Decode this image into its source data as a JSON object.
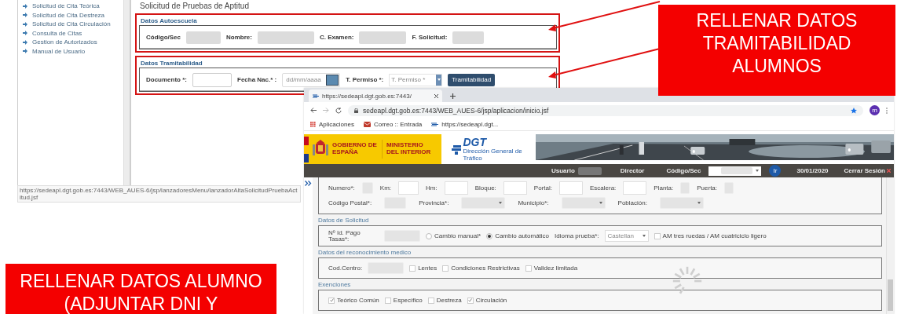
{
  "tutorial_screen": {
    "menu_items": [
      "Solicitud de Cita Teórica",
      "Solicitud de Cita Destreza",
      "Solicitud de Cita Circulación",
      "Consulta de Citas",
      "Gestion de Autorizados",
      "Manual de Usuario"
    ],
    "page_title": "Solicitud de Pruebas de Aptitud",
    "sections": [
      {
        "title": "Datos Autoescuela",
        "highlighted": true,
        "fields": [
          {
            "label": "Código/Sec",
            "kind": "blurred"
          },
          {
            "label": "Nombre:",
            "kind": "blurred"
          },
          {
            "label": "C. Examen:",
            "kind": "blurred"
          },
          {
            "label": "F. Solicitud:",
            "kind": "blurred"
          }
        ]
      },
      {
        "title": "Datos Tramitabilidad",
        "highlighted": true,
        "fields": [
          {
            "label": "Documento *:",
            "kind": "input"
          },
          {
            "label": "Fecha Nac.* :",
            "kind": "date",
            "placeholder": "dd/mm/aaaa"
          },
          {
            "label": "T. Permiso *:",
            "kind": "select",
            "placeholder": "T. Permiso *"
          },
          {
            "label": "Tramitabilidad",
            "kind": "button"
          }
        ]
      }
    ],
    "status_url": "https://sedeapl.dgt.gob.es:7443/WEB_AUES-6/jsp/lanzadoresMenu/lanzadorAltaSolicitudPruebaActitud.jsf"
  },
  "callouts": [
    {
      "text": "RELLENAR DATOS\nTRAMITABILIDAD\nALUMNOS"
    },
    {
      "text": "RELLENAR DATOS ALUMNO\n(ADJUNTAR DNI Y"
    }
  ],
  "browser": {
    "tab_title": "https://sedeapl.dgt.gob.es:7443/",
    "url": "sedeapl.dgt.gob.es:7443/WEB_AUES-6/jsp/aplicacion/inicio.jsf",
    "bookmarks": [
      {
        "label": "Aplicaciones",
        "kind": "apps"
      },
      {
        "label": "Correo :: Entrada",
        "kind": "mail"
      },
      {
        "label": "https://sedeapl.dgt...",
        "kind": "site"
      }
    ],
    "avatar": "m"
  },
  "site": {
    "government": "GOBIERNO DE ESPAÑA",
    "ministry": "MINISTERIO DEL INTERIOR",
    "logo": "DGT",
    "logo_caption": "Dirección General de Tráfico",
    "user_bar": {
      "user_label": "Usuario",
      "role": "Director",
      "code_label": "Código/Sec",
      "go": "Ir",
      "date": "30/01/2020",
      "logout": "Cerrar Sesión"
    },
    "address_rows": [
      [
        {
          "label": "Numero*:",
          "kind": "blurred"
        },
        {
          "label": "Km:",
          "kind": "input"
        },
        {
          "label": "Hm:",
          "kind": "input"
        },
        {
          "label": "Bloque:",
          "kind": "input"
        },
        {
          "label": "Portal:",
          "kind": "input"
        },
        {
          "label": "Escalera:",
          "kind": "input"
        },
        {
          "label": "Planta:",
          "kind": "blurred"
        },
        {
          "label": "Puerta:",
          "kind": "blurred"
        }
      ],
      [
        {
          "label": "Código Postal*:",
          "kind": "blurred"
        },
        {
          "label": "Provincia*:",
          "kind": "blurred_select"
        },
        {
          "label": "Municipio*:",
          "kind": "blurred_select"
        },
        {
          "label": "Población:",
          "kind": "blurred_select"
        }
      ]
    ],
    "sections": [
      {
        "title": "Datos de Solicitud",
        "items": [
          {
            "label": "Nº Id. Pago Tasas*:",
            "kind": "blurred"
          },
          {
            "label": "Cambio manual*",
            "kind": "radio",
            "selected": false
          },
          {
            "label": "Cambio automático",
            "kind": "radio",
            "selected": true
          },
          {
            "label": "Idioma prueba*:",
            "kind": "select",
            "value": "Castellan"
          },
          {
            "label": "AM tres ruedas / AM cuatriciclo ligero",
            "kind": "checkbox",
            "checked": false
          }
        ]
      },
      {
        "title": "Datos del reconocimiento medico",
        "items": [
          {
            "label": "Cod.Centro:",
            "kind": "blurred"
          },
          {
            "label": "Lentes",
            "kind": "checkbox",
            "checked": false
          },
          {
            "label": "Condiciones Restrictivas",
            "kind": "checkbox",
            "checked": false
          },
          {
            "label": "Validez limitada",
            "kind": "checkbox",
            "checked": false
          }
        ]
      },
      {
        "title": "Exenciones",
        "items": [
          {
            "label": "Teórico Común",
            "kind": "checkbox",
            "checked": true
          },
          {
            "label": "Específico",
            "kind": "checkbox",
            "checked": false
          },
          {
            "label": "Destreza",
            "kind": "checkbox",
            "checked": false
          },
          {
            "label": "Circulación",
            "kind": "checkbox",
            "checked": true
          }
        ]
      }
    ]
  }
}
